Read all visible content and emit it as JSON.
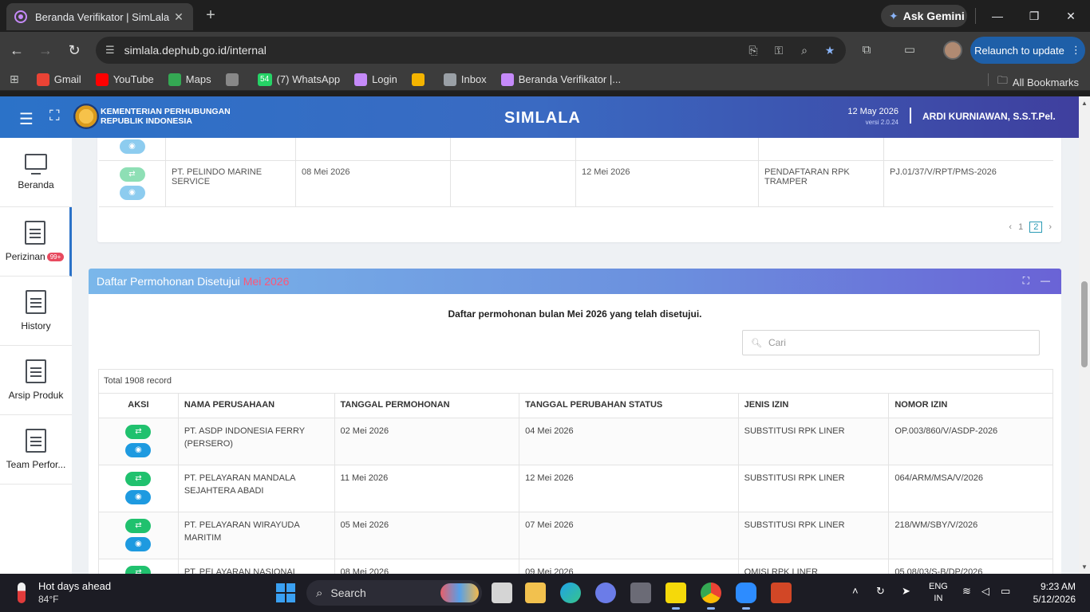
{
  "browser": {
    "tab_title": "Beranda Verifikator | SimLala",
    "gemini_label": "Ask Gemini",
    "url": "simlala.dephub.go.id/internal",
    "relaunch_label": "Relaunch to update",
    "bookmarks": [
      {
        "label": "Gmail",
        "color": "#ea4335",
        "icon": "gmail-icon"
      },
      {
        "label": "YouTube",
        "color": "#ff0000",
        "icon": "youtube-icon"
      },
      {
        "label": "Maps",
        "color": "#34a853",
        "icon": "maps-icon"
      },
      {
        "label": "",
        "color": "#888888",
        "icon": "globe-icon"
      },
      {
        "label": "(7) WhatsApp",
        "color": "#25d366",
        "icon": "whatsapp-icon",
        "badge": "54"
      },
      {
        "label": "Login",
        "color": "#c58af9",
        "icon": "simlala-icon"
      },
      {
        "label": "",
        "color": "#f4b400",
        "icon": "pinwheel-icon"
      },
      {
        "label": "Inbox",
        "color": "#9aa0a6",
        "icon": "mail-icon"
      },
      {
        "label": "Beranda Verifikator |...",
        "color": "#c58af9",
        "icon": "simlala-icon"
      }
    ],
    "all_bookmarks_label": "All Bookmarks"
  },
  "header": {
    "ministry_line1": "KEMENTERIAN PERHUBUNGAN",
    "ministry_line2": "REPUBLIK INDONESIA",
    "app_title": "SIMLALA",
    "date": "12 May 2026",
    "version": "versi 2.0.24",
    "user": "ARDI KURNIAWAN, S.S.T.Pel."
  },
  "sidebar": {
    "items": [
      {
        "label": "Beranda",
        "icon": "monitor-icon"
      },
      {
        "label": "Perizinan",
        "icon": "document-icon",
        "badge": "99+"
      },
      {
        "label": "History",
        "icon": "document-icon"
      },
      {
        "label": "Arsip Produk",
        "icon": "document-icon"
      },
      {
        "label": "Team Perfor...",
        "icon": "document-icon"
      }
    ]
  },
  "top_table": {
    "last_row": {
      "perusahaan": "PT. PELINDO MARINE SERVICE",
      "tanggal_permohonan": "08 Mei 2026",
      "tanggal_perubahan": "12 Mei 2026",
      "jenis_izin": "PENDAFTARAN RPK TRAMPER",
      "nomor_izin": "PJ.01/37/V/RPT/PMS-2026"
    },
    "pager": {
      "prev": "‹",
      "page1": "1",
      "page2": "2",
      "next": "›"
    }
  },
  "approved": {
    "title": "Daftar Permohonan Disetujui",
    "month": "Mei 2026",
    "subtitle": "Daftar permohonan bulan Mei 2026 yang telah disetujui.",
    "search_placeholder": "Cari",
    "total": "Total 1908 record",
    "columns": [
      "AKSI",
      "NAMA PERUSAHAAN",
      "TANGGAL PERMOHONAN",
      "TANGGAL PERUBAHAN STATUS",
      "JENIS IZIN",
      "NOMOR IZIN"
    ],
    "rows": [
      {
        "perusahaan": "PT. ASDP INDONESIA FERRY (PERSERO)",
        "tgl_permohonan": "02 Mei 2026",
        "tgl_perubahan": "04 Mei 2026",
        "jenis": "SUBSTITUSI RPK LINER",
        "nomor": "OP.003/860/V/ASDP-2026"
      },
      {
        "perusahaan": "PT. PELAYARAN MANDALA SEJAHTERA ABADI",
        "tgl_permohonan": "11 Mei 2026",
        "tgl_perubahan": "12 Mei 2026",
        "jenis": "SUBSTITUSI RPK LINER",
        "nomor": "064/ARM/MSA/V/2026"
      },
      {
        "perusahaan": "PT. PELAYARAN WIRAYUDA MARITIM",
        "tgl_permohonan": "05 Mei 2026",
        "tgl_perubahan": "07 Mei 2026",
        "jenis": "SUBSTITUSI RPK LINER",
        "nomor": "218/WM/SBY/V/2026"
      },
      {
        "perusahaan": "PT. PELAYARAN NASIONAL",
        "tgl_permohonan": "08 Mei 2026",
        "tgl_perubahan": "09 Mei 2026",
        "jenis": "OMISI RPK LINER",
        "nomor": "05.08/03/S-B/DP/2026"
      }
    ]
  },
  "taskbar": {
    "weather_title": "Hot days ahead",
    "weather_temp": "84°F",
    "search_label": "Search",
    "lang_line1": "ENG",
    "lang_line2": "IN",
    "time": "9:23 AM",
    "date": "5/12/2026"
  }
}
